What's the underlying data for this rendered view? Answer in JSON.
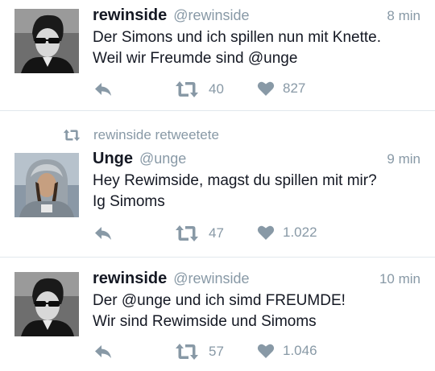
{
  "tweets": [
    {
      "name": "rewinside",
      "handle": "@rewinside",
      "time": "8 min",
      "text": "Der Simons und ich spillen nun mit Knette.\nWeil wir Freumde sind @unge",
      "retweets": "40",
      "likes": "827"
    },
    {
      "context": "rewinside retweetete",
      "name": "Unge",
      "handle": "@unge",
      "time": "9 min",
      "text": "Hey Rewimside, magst du spillen mit mir?\nIg Simoms",
      "retweets": "47",
      "likes": "1.022"
    },
    {
      "name": "rewinside",
      "handle": "@rewinside",
      "time": "10 min",
      "text": "Der @unge und ich simd FREUMDE!\nWir sind Rewimside und Simoms",
      "retweets": "57",
      "likes": "1.046"
    }
  ],
  "icons": {
    "reply": "reply-icon",
    "retweet": "retweet-icon",
    "like": "heart-icon"
  },
  "colors": {
    "muted": "#8899a6",
    "text": "#141823",
    "divider": "#e1e8ed"
  }
}
